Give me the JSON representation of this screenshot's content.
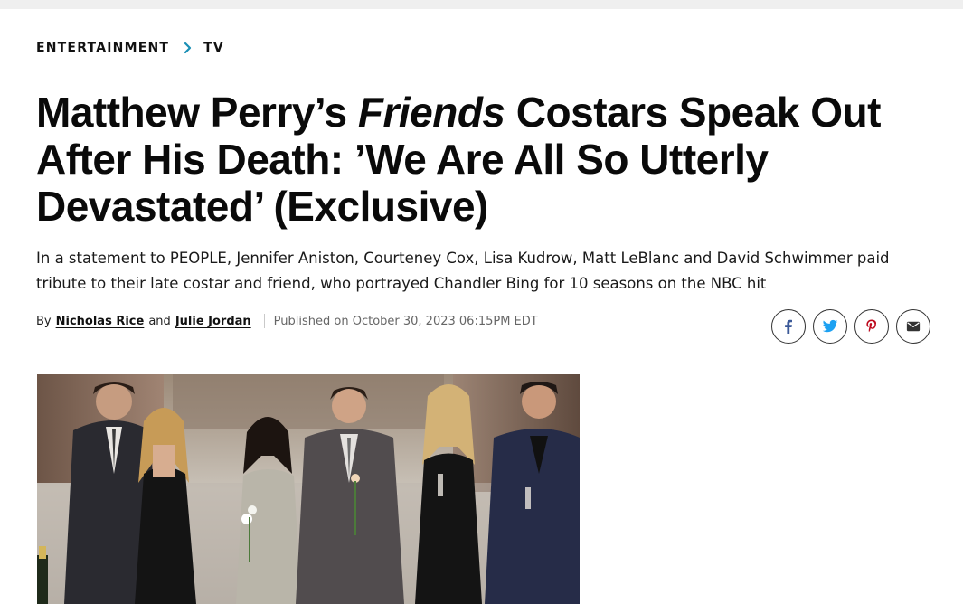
{
  "breadcrumb": {
    "items": [
      {
        "label": "ENTERTAINMENT"
      },
      {
        "label": "TV"
      }
    ]
  },
  "headline": {
    "part1": "Matthew Perry’s ",
    "italic": "Friends",
    "part2": " Costars Speak Out After His Death: ’We Are All So Utterly Devastated’ (Exclusive)"
  },
  "subhead": "In a statement to PEOPLE, Jennifer Aniston, Courteney Cox, Lisa Kudrow, Matt LeBlanc and David Schwimmer paid tribute to their late costar and friend, who portrayed Chandler Bing for 10 seasons on the NBC hit",
  "byline": {
    "by": "By",
    "author1": "Nicholas Rice",
    "and": "and",
    "author2": "Julie Jordan",
    "published": "Published on October 30, 2023 06:15PM EDT"
  },
  "share": {
    "buttons": [
      {
        "icon": "facebook-icon",
        "color": "#3b5998"
      },
      {
        "icon": "twitter-icon",
        "color": "#1da1f2"
      },
      {
        "icon": "pinterest-icon",
        "color": "#bd081c"
      },
      {
        "icon": "email-icon",
        "color": "#333333"
      }
    ]
  },
  "colors": {
    "accent": "#1a8fb5",
    "text": "#111111"
  }
}
